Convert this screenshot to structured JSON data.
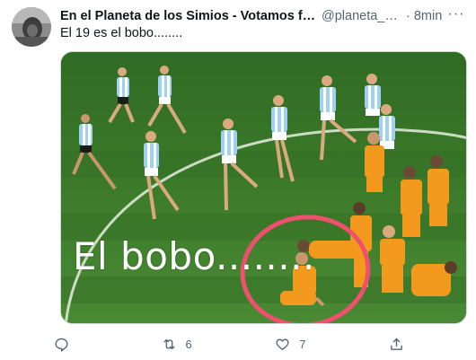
{
  "tweet": {
    "display_name": "En el Planeta de los Simios - Votamos fantá...",
    "handle": "@planeta_si...",
    "separator": "·",
    "time": "8min",
    "more_label": "···",
    "text": "El 19 es el bobo........",
    "avatar_icon": "avatar-photo-icon"
  },
  "media": {
    "caption": "El bobo........",
    "highlight_color": "#f0506e",
    "field_color": "#3f7a2e",
    "argentina_shirt": "#9fd2f0",
    "netherlands_shirt": "#f39a1e"
  },
  "actions": {
    "reply": {
      "icon": "reply-icon",
      "count": ""
    },
    "retweet": {
      "icon": "retweet-icon",
      "count": "6"
    },
    "like": {
      "icon": "heart-icon",
      "count": "7"
    },
    "share": {
      "icon": "share-icon",
      "count": ""
    }
  }
}
